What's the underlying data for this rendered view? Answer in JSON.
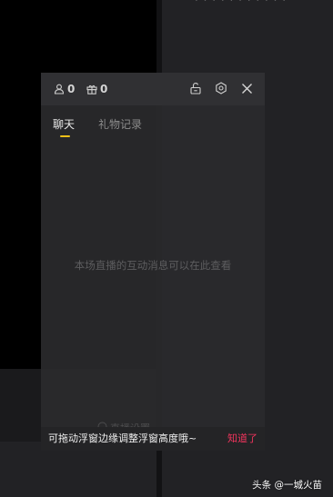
{
  "header": {
    "viewer_count": "0",
    "gift_count": "0"
  },
  "tabs": [
    {
      "label": "聊天",
      "active": true
    },
    {
      "label": "礼物记录",
      "active": false
    }
  ],
  "chat": {
    "empty_message": "本场直播的互动消息可以在此查看"
  },
  "live_hint": "直播设置",
  "tooltip": {
    "message": "可拖动浮窗边缘调整浮窗高度哦~",
    "action": "知道了"
  },
  "top_cut_text": "· · · · · · · · · · ·",
  "watermark": "头条 @一城火苗",
  "colors": {
    "accent_tab_indicator": "#f2c018",
    "tooltip_action": "#f0345c"
  },
  "icons": {
    "viewer": "person-icon",
    "gift": "gift-icon",
    "lock": "unlock-icon",
    "settings": "settings-icon",
    "close": "close-icon"
  }
}
